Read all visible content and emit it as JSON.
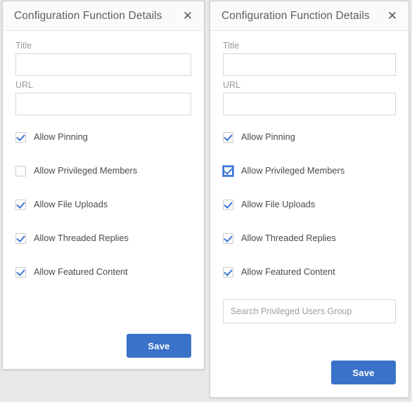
{
  "colors": {
    "accent": "#3a76d8",
    "save_button": "#3a72c8",
    "header_bg": "#fafafa",
    "border": "#cfcfcf",
    "label_text": "#9a9a9a",
    "body_text": "#4a4a4a",
    "page_bg": "#e9e9e9"
  },
  "panels": [
    {
      "id": "left",
      "header": {
        "title": "Configuration Function Details",
        "close_icon": "close-icon",
        "close_label": "✕"
      },
      "fields": {
        "title": {
          "label": "Title",
          "value": "",
          "placeholder": ""
        },
        "url": {
          "label": "URL",
          "value": "",
          "placeholder": ""
        }
      },
      "checkboxes": [
        {
          "label": "Allow Pinning",
          "checked": true,
          "focused": false
        },
        {
          "label": "Allow Privileged Members",
          "checked": false,
          "focused": false
        },
        {
          "label": "Allow File Uploads",
          "checked": true,
          "focused": false
        },
        {
          "label": "Allow Threaded Replies",
          "checked": true,
          "focused": false
        },
        {
          "label": "Allow Featured Content",
          "checked": true,
          "focused": false
        }
      ],
      "search": null,
      "save_label": "Save"
    },
    {
      "id": "right",
      "header": {
        "title": "Configuration Function Details",
        "close_icon": "close-icon",
        "close_label": "✕"
      },
      "fields": {
        "title": {
          "label": "Title",
          "value": "",
          "placeholder": ""
        },
        "url": {
          "label": "URL",
          "value": "",
          "placeholder": ""
        }
      },
      "checkboxes": [
        {
          "label": "Allow Pinning",
          "checked": true,
          "focused": false
        },
        {
          "label": "Allow Privileged Members",
          "checked": true,
          "focused": true
        },
        {
          "label": "Allow File Uploads",
          "checked": true,
          "focused": false
        },
        {
          "label": "Allow Threaded Replies",
          "checked": true,
          "focused": false
        },
        {
          "label": "Allow Featured Content",
          "checked": true,
          "focused": false
        }
      ],
      "search": {
        "value": "",
        "placeholder": "Search Privileged Users Group"
      },
      "save_label": "Save"
    }
  ]
}
